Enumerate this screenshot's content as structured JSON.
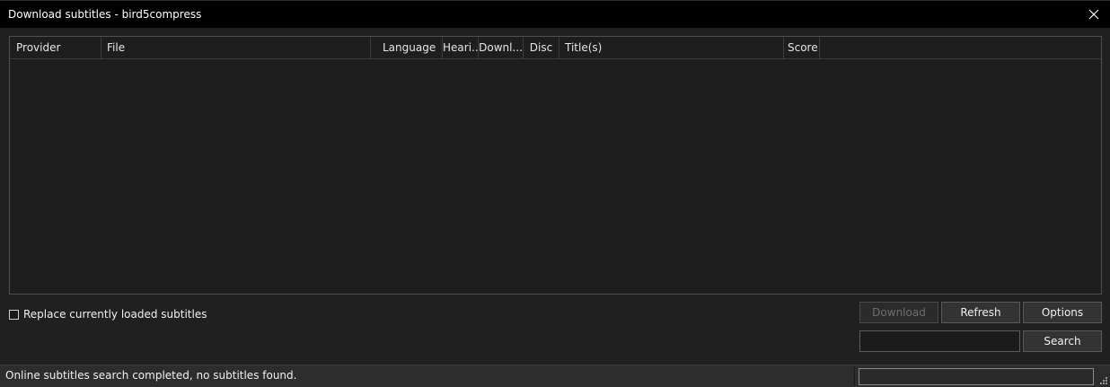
{
  "window": {
    "title": "Download subtitles - bird5compress",
    "close_icon": "close-icon"
  },
  "list": {
    "columns": [
      "Provider",
      "File",
      "Language",
      "Heari...",
      "Downl...",
      "Disc",
      "Title(s)",
      "Score"
    ],
    "rows": []
  },
  "options": {
    "replace_label": "Replace currently loaded subtitles",
    "replace_checked": false
  },
  "buttons": {
    "download_label": "Download",
    "refresh_label": "Refresh",
    "options_label": "Options",
    "search_label": "Search"
  },
  "search": {
    "value": "",
    "placeholder": ""
  },
  "status": {
    "message": "Online subtitles search completed, no subtitles found.",
    "progress": 0
  }
}
